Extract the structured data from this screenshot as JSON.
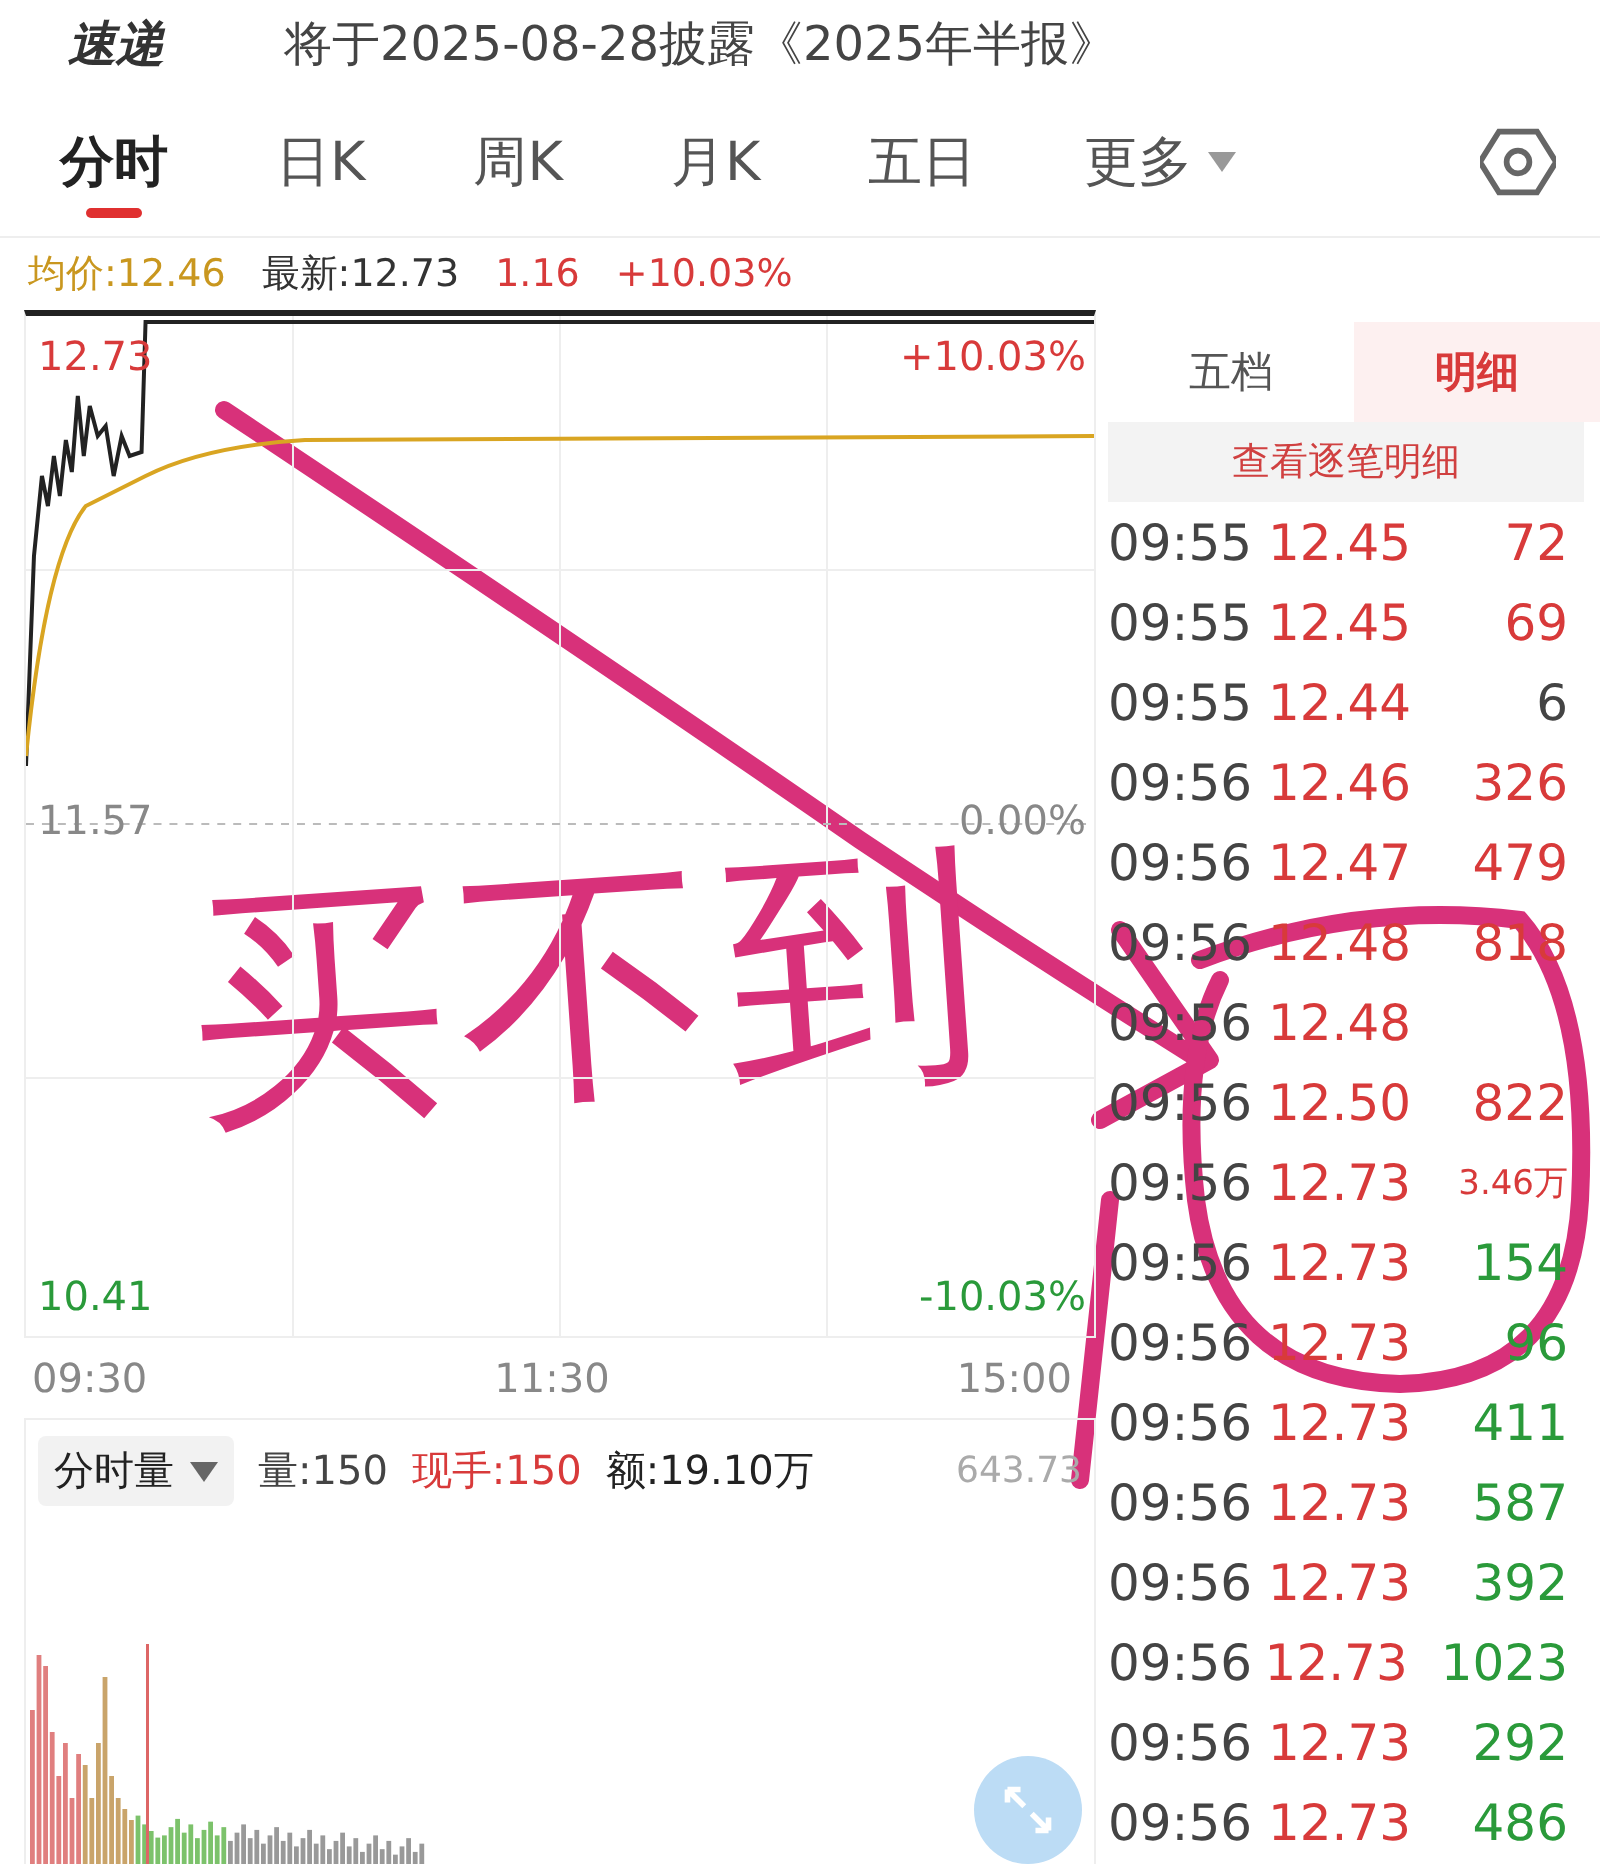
{
  "header": {
    "logo": "速递",
    "title": "将于2025-08-28披露《2025年半报》"
  },
  "tabs": [
    {
      "label": "分时",
      "selected": true,
      "dropdown": false
    },
    {
      "label": "日K",
      "selected": false,
      "dropdown": false
    },
    {
      "label": "周K",
      "selected": false,
      "dropdown": false
    },
    {
      "label": "月K",
      "selected": false,
      "dropdown": false
    },
    {
      "label": "五日",
      "selected": false,
      "dropdown": false
    },
    {
      "label": "更多",
      "selected": false,
      "dropdown": true
    }
  ],
  "quote": [
    {
      "text": "均价:12.46",
      "color": "#c9971f"
    },
    {
      "text": "最新:12.73",
      "color": "#333333"
    },
    {
      "text": "1.16",
      "color": "#d83a3a"
    },
    {
      "text": "+10.03%",
      "color": "#d83a3a"
    }
  ],
  "chart": {
    "high": "12.73",
    "high_pct": "+10.03%",
    "mid": "11.57",
    "mid_pct": "0.00%",
    "low": "10.41",
    "low_pct": "-10.03%",
    "times": [
      "09:30",
      "11:30",
      "15:00"
    ]
  },
  "volume": {
    "selector": "分时量",
    "stats": [
      {
        "text": "量:150",
        "color": "#444444"
      },
      {
        "text": "现手:150",
        "color": "#d83a3a"
      },
      {
        "text": "额:19.10万",
        "color": "#222222"
      }
    ],
    "max": "643.73"
  },
  "side_tabs": [
    {
      "label": "五档",
      "selected": false
    },
    {
      "label": "明细",
      "selected": true
    }
  ],
  "detail_button": "查看逐笔明细",
  "trades": [
    {
      "time": "09:55",
      "price": "12.45",
      "vol": "72",
      "color": "#d83a3a"
    },
    {
      "time": "09:55",
      "price": "12.45",
      "vol": "69",
      "color": "#d83a3a"
    },
    {
      "time": "09:55",
      "price": "12.44",
      "vol": "6",
      "color": "#444444"
    },
    {
      "time": "09:56",
      "price": "12.46",
      "vol": "326",
      "color": "#d83a3a"
    },
    {
      "time": "09:56",
      "price": "12.47",
      "vol": "479",
      "color": "#d83a3a"
    },
    {
      "time": "09:56",
      "price": "12.48",
      "vol": "818",
      "color": "#d83a3a"
    },
    {
      "time": "09:56",
      "price": "12.48"
    },
    {
      "time": "09:56",
      "price": "12.50",
      "vol": "822",
      "color": "#d83a3a"
    },
    {
      "time": "09:56",
      "price": "12.73",
      "vol": "3.46万",
      "color": "#d83a3a"
    },
    {
      "time": "09:56",
      "price": "12.73",
      "vol": "154",
      "color": "#2a9a3a"
    },
    {
      "time": "09:56",
      "price": "12.73",
      "vol": "96",
      "color": "#2a9a3a"
    },
    {
      "time": "09:56",
      "price": "12.73",
      "vol": "411",
      "color": "#2a9a3a"
    },
    {
      "time": "09:56",
      "price": "12.73",
      "vol": "587",
      "color": "#2a9a3a"
    },
    {
      "time": "09:56",
      "price": "12.73",
      "vol": "392",
      "color": "#2a9a3a"
    },
    {
      "time": "09:56",
      "price": "12.73",
      "vol": "1023",
      "color": "#2a9a3a"
    },
    {
      "time": "09:56",
      "price": "12.73",
      "vol": "292",
      "color": "#2a9a3a"
    },
    {
      "time": "09:56",
      "price": "12.73",
      "vol": "486",
      "color": "#2a9a3a"
    }
  ],
  "annotation": {
    "note": "买不到"
  }
}
